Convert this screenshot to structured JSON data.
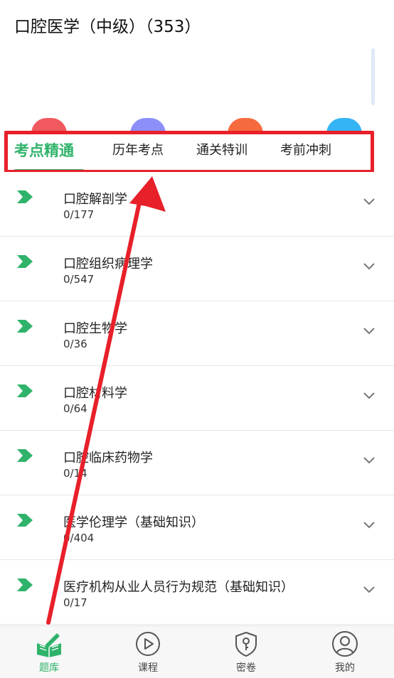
{
  "header": {
    "title": "口腔医学（中级）（353）"
  },
  "tabs": [
    {
      "label": "考点精通",
      "active": true
    },
    {
      "label": "历年考点",
      "active": false
    },
    {
      "label": "通关特训",
      "active": false
    },
    {
      "label": "考前冲刺",
      "active": false
    }
  ],
  "icon_row_colors": [
    "#f0595f",
    "#8c8ff7",
    "#f56b3d",
    "#35b4f5"
  ],
  "list": [
    {
      "name": "口腔解剖学",
      "count": "0/177"
    },
    {
      "name": "口腔组织病理学",
      "count": "0/547"
    },
    {
      "name": "口腔生物学",
      "count": "0/36"
    },
    {
      "name": "口腔材料学",
      "count": "0/64"
    },
    {
      "name": "口腔临床药物学",
      "count": "0/14"
    },
    {
      "name": "医学伦理学（基础知识）",
      "count": "0/404"
    },
    {
      "name": "医疗机构从业人员行为规范（基础知识）",
      "count": "0/17"
    }
  ],
  "tabbar": [
    {
      "label": "题库",
      "icon": "book-pen-icon",
      "active": true
    },
    {
      "label": "课程",
      "icon": "play-circle-icon",
      "active": false
    },
    {
      "label": "密卷",
      "icon": "shield-key-icon",
      "active": false
    },
    {
      "label": "我的",
      "icon": "user-icon",
      "active": false
    }
  ],
  "colors": {
    "accent": "#2fb36a",
    "annotation": "#e8202a"
  }
}
